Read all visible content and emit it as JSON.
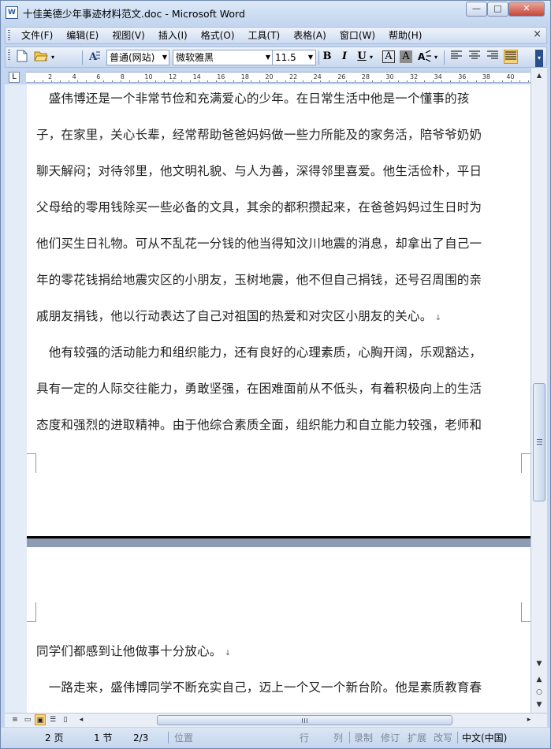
{
  "window": {
    "title": "十佳美德少年事迹材料范文.doc - Microsoft Word",
    "app_icon": "W",
    "controls": {
      "minimize": "—",
      "maximize": "□",
      "close": "✕"
    }
  },
  "menu": {
    "items": [
      "文件(F)",
      "编辑(E)",
      "视图(V)",
      "插入(I)",
      "格式(O)",
      "工具(T)",
      "表格(A)",
      "窗口(W)",
      "帮助(H)"
    ],
    "close_doc": "×"
  },
  "toolbar": {
    "style": "普通(网站)",
    "font": "微软雅黑",
    "size": "11.5",
    "bold": "B",
    "italic": "I",
    "underline": "U",
    "font_color": "A",
    "highlight": "A",
    "icons": [
      "new-doc-icon",
      "open-folder-icon",
      "styles-icon",
      "bold-icon",
      "italic-icon",
      "underline-icon",
      "char-border-icon",
      "char-shading-icon",
      "text-effect-icon",
      "align-left-icon",
      "align-center-icon",
      "align-right-icon",
      "justify-icon"
    ]
  },
  "ruler": {
    "tab_selector": "L",
    "numbers": [
      "2",
      "4",
      "6",
      "8",
      "10",
      "12",
      "14",
      "16",
      "18",
      "20",
      "22",
      "24",
      "26",
      "28",
      "30",
      "32",
      "34",
      "36",
      "38",
      "40"
    ]
  },
  "document": {
    "page1_lines": [
      "　盛伟博还是一个非常节俭和充满爱心的少年。在日常生活中他是一个懂事的孩",
      "子，在家里，关心长辈，经常帮助爸爸妈妈做一些力所能及的家务活，陪爷爷奶奶",
      "聊天解闷；对待邻里，他文明礼貌、与人为善，深得邻里喜爱。他生活俭朴，平日",
      "父母给的零用钱除买一些必备的文具，其余的都积攒起来，在爸爸妈妈过生日时为",
      "他们买生日礼物。可从不乱花一分钱的他当得知汶川地震的消息，却拿出了自己一",
      "年的零花钱捐给地震灾区的小朋友，玉树地震，他不但自己捐钱，还号召周围的亲",
      "戚朋友捐钱，他以行动表达了自己对祖国的热爱和对灾区小朋友的关心。",
      "　他有较强的活动能力和组织能力，还有良好的心理素质，心胸开阔，乐观豁达，",
      "具有一定的人际交往能力，勇敢坚强，在困难面前从不低头，有着积极向上的生活",
      "态度和强烈的进取精神。由于他综合素质全面，组织能力和自立能力较强，老师和"
    ],
    "page2_lines": [
      "同学们都感到让他做事十分放心。",
      "　一路走来，盛伟博同学不断充实自己，迈上一个又一个新台阶。他是素质教育春"
    ],
    "pilcrow": "↓"
  },
  "scrollbars": {
    "vertical_position": 0.48
  },
  "statusbar": {
    "page": "2 页",
    "section": "1 节",
    "page_of": "2/3",
    "position": "位置",
    "line": "行",
    "col": "列",
    "rec": "录制",
    "trk": "修订",
    "ext": "扩展",
    "ovr": "改写",
    "language": "中文(中国)"
  }
}
